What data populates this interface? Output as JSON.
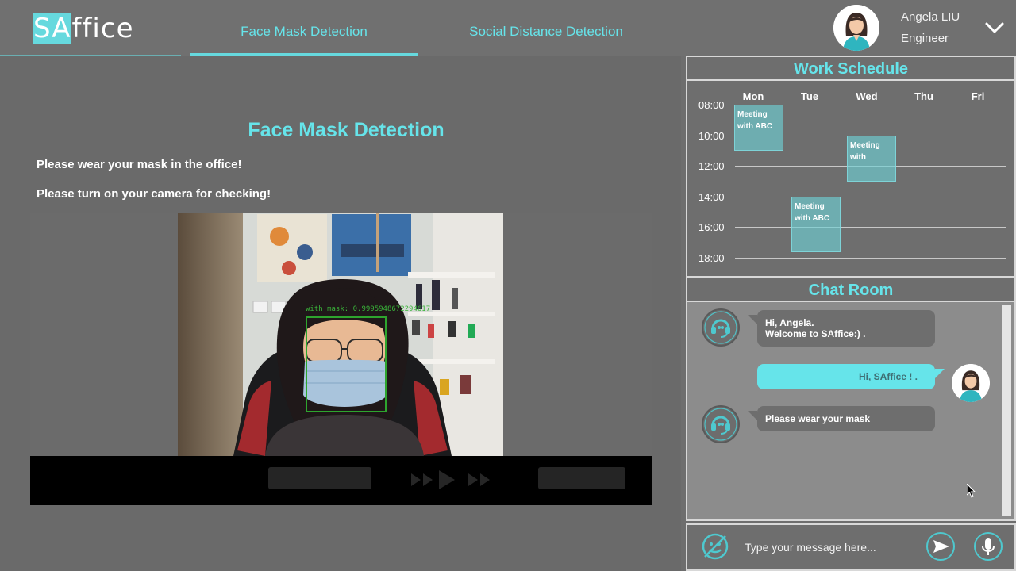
{
  "app": {
    "logo_highlight": "SA",
    "logo_rest": "ffice",
    "accent_color": "#66d9de"
  },
  "nav": {
    "tabs": [
      {
        "label": "Face Mask Detection",
        "active": true
      },
      {
        "label": "Social Distance Detection",
        "active": false
      }
    ]
  },
  "user": {
    "name": "Angela LIU",
    "role": "Engineer",
    "menu_icon": "chevron-down-icon"
  },
  "main": {
    "title": "Face Mask Detection",
    "instruction_1": "Please wear your mask in the office!",
    "instruction_2": "Please turn on your camera for checking!",
    "detection_label": "with_mask: 0.9995948672294617"
  },
  "schedule": {
    "title": "Work Schedule",
    "days": [
      "Mon",
      "Tue",
      "Wed",
      "Thu",
      "Fri"
    ],
    "hours": [
      "08:00",
      "10:00",
      "12:00",
      "14:00",
      "16:00",
      "18:00"
    ],
    "events": [
      {
        "day": "Mon",
        "start": "08:00",
        "end": "11:00",
        "text": "Meeting with ABC"
      },
      {
        "day": "Wed",
        "start": "10:00",
        "end": "13:00",
        "text": "Meeting with"
      },
      {
        "day": "Tue",
        "start": "14:00",
        "end": "17:30",
        "text": "Meeting with ABC"
      }
    ]
  },
  "chat": {
    "title": "Chat Room",
    "messages": [
      {
        "from": "bot",
        "line1": "Hi, Angela.",
        "line2": "Welcome to SAffice:) ."
      },
      {
        "from": "me",
        "line1": "Hi, SAffice ! ."
      },
      {
        "from": "bot",
        "line1": "Please wear your mask"
      }
    ],
    "input_placeholder": "Type your message here..."
  }
}
